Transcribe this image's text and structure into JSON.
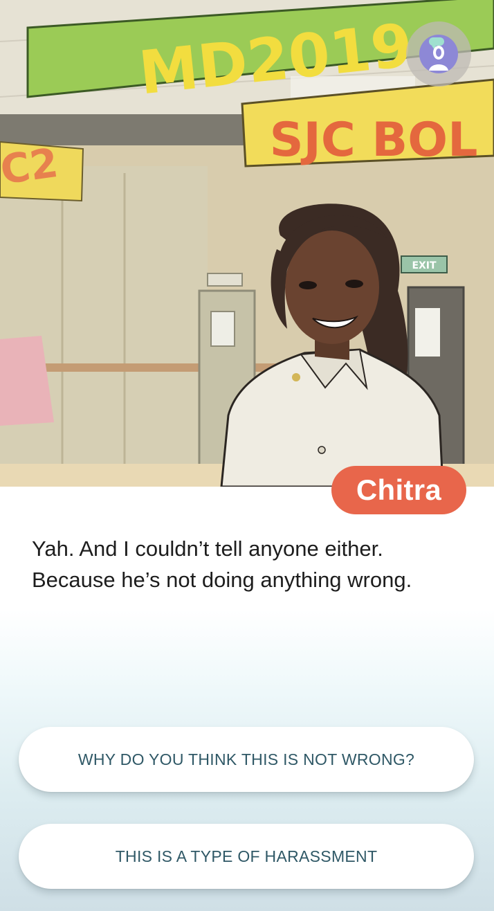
{
  "scene": {
    "banner_top_text": "MD2019",
    "banner_second_text": "SJC BOL",
    "banner_left_text": "C2",
    "exit_sign_text": "EXIT"
  },
  "profile": {
    "icon": "user-profile-icon",
    "accent": "#8d88d6"
  },
  "speaker": {
    "name": "Chitra",
    "color": "#e8664b"
  },
  "dialogue": {
    "line1": "Yah. And I couldn’t tell anyone either.",
    "line2": "Because he’s not doing anything wrong."
  },
  "choices": [
    {
      "label": "WHY DO YOU THINK THIS IS NOT WRONG?"
    },
    {
      "label": "THIS IS A TYPE OF HARASSMENT"
    }
  ],
  "colors": {
    "choice_text": "#2f5866",
    "dialogue_text": "#1d1d1d"
  }
}
